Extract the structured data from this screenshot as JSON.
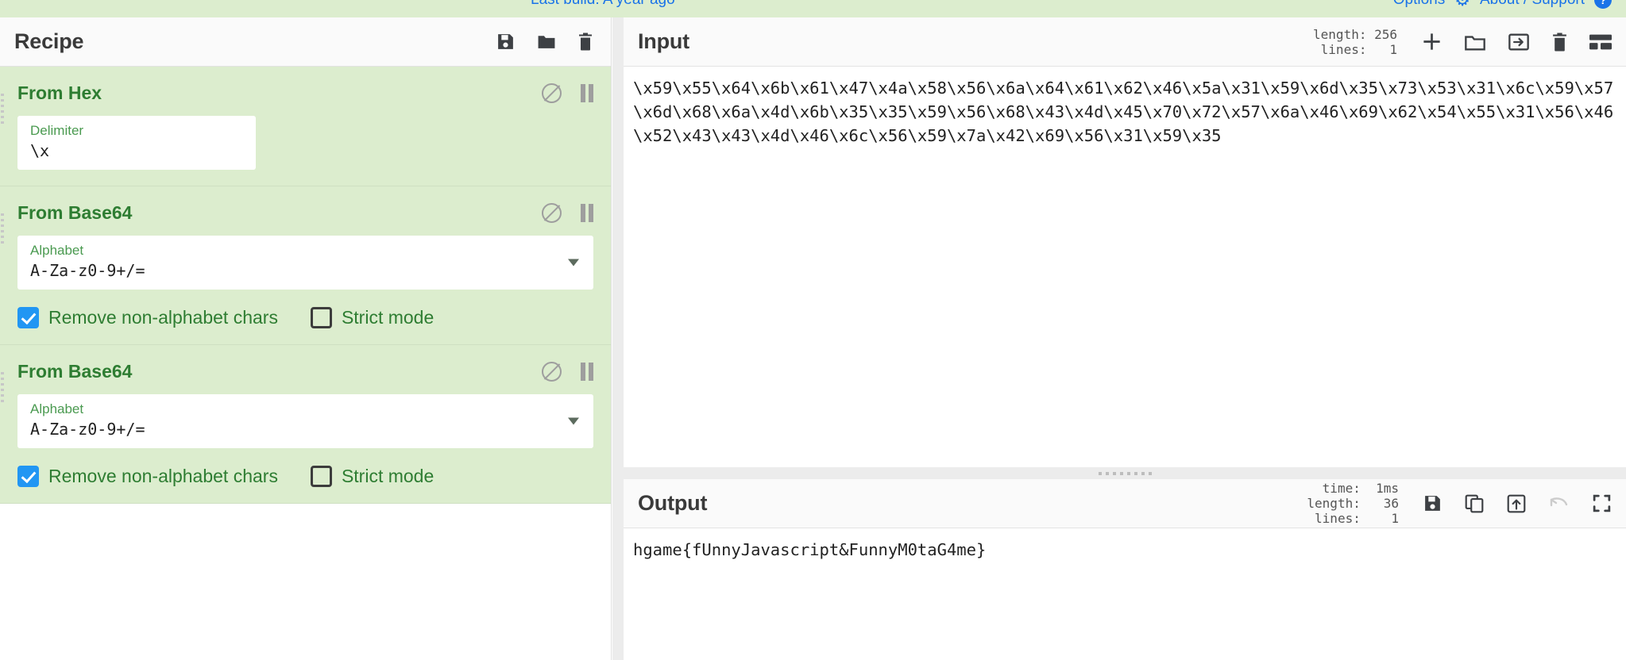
{
  "topbar": {
    "last_build": "Last build: A year ago",
    "options_label": "Options",
    "options_icon": "gear-icon",
    "about_label": "About / Support",
    "about_icon": "question-circle-icon"
  },
  "recipe": {
    "title": "Recipe",
    "icons": [
      {
        "name": "save-recipe-icon",
        "glyph": "floppy-disk"
      },
      {
        "name": "load-recipe-icon",
        "glyph": "folder"
      },
      {
        "name": "clear-recipe-icon",
        "glyph": "trash"
      }
    ],
    "operations": [
      {
        "name": "From Hex",
        "disable_icon": "disable-icon",
        "pause_icon": "breakpoint-pause-icon",
        "args": [
          {
            "type": "text",
            "label": "Delimiter",
            "value": "\\x",
            "width": "short"
          }
        ],
        "checkboxes": []
      },
      {
        "name": "From Base64",
        "disable_icon": "disable-icon",
        "pause_icon": "breakpoint-pause-icon",
        "args": [
          {
            "type": "select",
            "label": "Alphabet",
            "value": "A-Za-z0-9+/=",
            "width": "full"
          }
        ],
        "checkboxes": [
          {
            "label": "Remove non-alphabet chars",
            "checked": true
          },
          {
            "label": "Strict mode",
            "checked": false
          }
        ]
      },
      {
        "name": "From Base64",
        "disable_icon": "disable-icon",
        "pause_icon": "breakpoint-pause-icon",
        "args": [
          {
            "type": "select",
            "label": "Alphabet",
            "value": "A-Za-z0-9+/=",
            "width": "full"
          }
        ],
        "checkboxes": [
          {
            "label": "Remove non-alphabet chars",
            "checked": true
          },
          {
            "label": "Strict mode",
            "checked": false
          }
        ]
      }
    ]
  },
  "input": {
    "title": "Input",
    "meta": "length: 256\n lines:   1",
    "length_label": "length:",
    "length_value": "256",
    "lines_label": "lines:",
    "lines_value": "1",
    "text": "\\x59\\x55\\x64\\x6b\\x61\\x47\\x4a\\x58\\x56\\x6a\\x64\\x61\\x62\\x46\\x5a\\x31\\x59\\x6d\\x35\\x73\\x53\\x31\\x6c\\x59\\x57\\x6d\\x68\\x6a\\x4d\\x6b\\x35\\x35\\x59\\x56\\x68\\x43\\x4d\\x45\\x70\\x72\\x57\\x6a\\x46\\x69\\x62\\x54\\x55\\x31\\x56\\x46\\x52\\x43\\x43\\x4d\\x46\\x6c\\x56\\x59\\x7a\\x42\\x69\\x56\\x31\\x59\\x35",
    "icons": [
      {
        "name": "add-input-tab-icon",
        "glyph": "plus"
      },
      {
        "name": "open-folder-icon",
        "glyph": "folder-open"
      },
      {
        "name": "open-input-as-tabs-icon",
        "glyph": "import-arrow"
      },
      {
        "name": "clear-input-icon",
        "glyph": "trash"
      },
      {
        "name": "reset-pane-layout-icon",
        "glyph": "layout-grid"
      }
    ]
  },
  "output": {
    "title": "Output",
    "time_label": "time:",
    "time_value": "1ms",
    "length_label": "length:",
    "length_value": "36",
    "lines_label": "lines:",
    "lines_value": "1",
    "meta": "  time:  1ms\nlength:   36\n lines:    1",
    "text": "hgame{fUnnyJavascript&FunnyM0taG4me}",
    "icons": [
      {
        "name": "save-output-icon",
        "glyph": "floppy-disk"
      },
      {
        "name": "copy-output-icon",
        "glyph": "copy"
      },
      {
        "name": "replace-input-with-output-icon",
        "glyph": "export-up"
      },
      {
        "name": "undo-icon",
        "glyph": "undo-arrow",
        "disabled": true
      },
      {
        "name": "maximise-output-icon",
        "glyph": "expand"
      }
    ]
  },
  "colors": {
    "recipe_background": "#dcedce",
    "operation_title": "#2e7d32",
    "checkbox_accent": "#2196f3",
    "link": "#1a73e8",
    "panel_header": "#fafafa"
  }
}
